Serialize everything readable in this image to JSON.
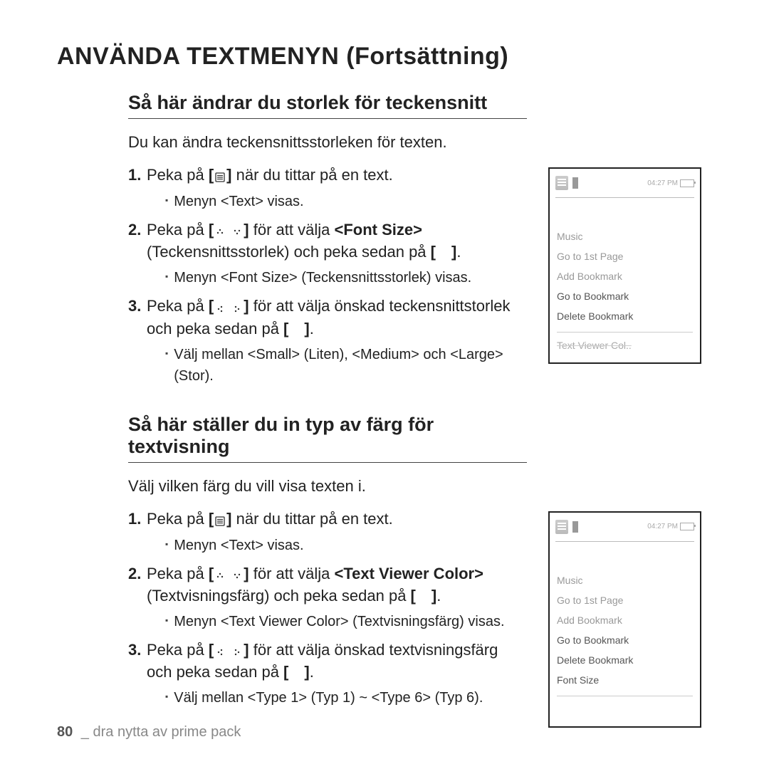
{
  "title": "ANVÄNDA TEXTMENYN (Fortsättning)",
  "section1": {
    "heading": "Så här ändrar du storlek för teckensnitt",
    "intro": "Du kan ändra teckensnittsstorleken för texten.",
    "step1_a": "Peka på ",
    "step1_b": " när du tittar på en text.",
    "step1_sub": "Menyn <Text> visas.",
    "step2_a": "Peka på ",
    "step2_b": " för att välja ",
    "step2_bold": "<Font Size>",
    "step2_c": " (Teckensnittsstorlek) och peka sedan på ",
    "step2_d": ".",
    "step2_sub": "Menyn <Font Size> (Teckensnittsstorlek) visas.",
    "step3_a": "Peka på ",
    "step3_b": " för att välja önskad teckensnittstorlek och peka sedan på ",
    "step3_c": ".",
    "step3_sub": "Välj mellan <Small> (Liten), <Medium> och <Large> (Stor)."
  },
  "section2": {
    "heading": "Så här ställer du in typ av färg för textvisning",
    "intro": "Välj vilken färg du vill visa texten i.",
    "step1_a": "Peka på ",
    "step1_b": " när du tittar på en text.",
    "step1_sub": "Menyn <Text> visas.",
    "step2_a": "Peka på ",
    "step2_b": " för att välja ",
    "step2_bold": "<Text Viewer Color>",
    "step2_c": " (Textvisningsfärg) och peka sedan på ",
    "step2_d": ".",
    "step2_sub": "Menyn <Text Viewer Color> (Textvisningsfärg) visas.",
    "step3_a": "Peka på ",
    "step3_b": " för att välja önskad textvisningsfärg och peka sedan på ",
    "step3_c": ".",
    "step3_sub": "Välj mellan <Type 1> (Typ 1) ~ <Type 6> (Typ 6)."
  },
  "device1": {
    "clock": "04:27 PM",
    "items": [
      "Music",
      "Go to 1st Page",
      "Add Bookmark",
      "Go to Bookmark",
      "Delete Bookmark"
    ],
    "cut": "Text Viewer Col.."
  },
  "device2": {
    "clock": "04:27 PM",
    "items": [
      "Music",
      "Go to 1st Page",
      "Add Bookmark",
      "Go to Bookmark",
      "Delete Bookmark",
      "Font Size"
    ]
  },
  "footer": {
    "page": "80",
    "sep": " _ ",
    "text": "dra nytta av prime pack"
  },
  "brackets": {
    "open": "[",
    "close": "]",
    "empty": "[ ]"
  }
}
